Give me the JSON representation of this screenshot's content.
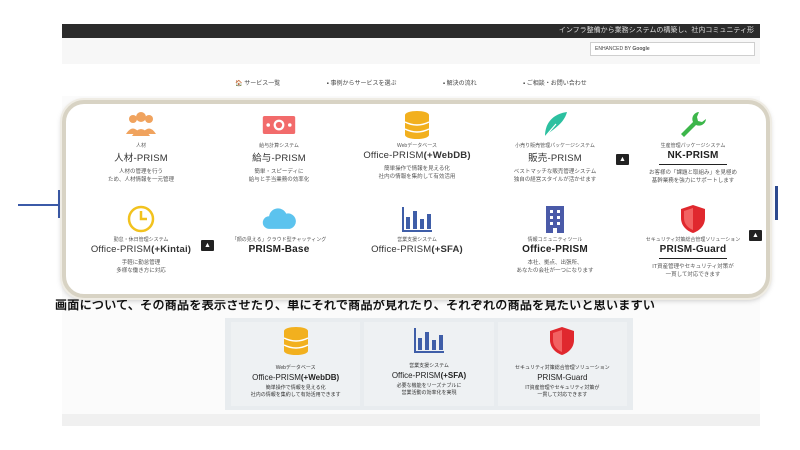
{
  "site": {
    "topbar_text": "インフラ整備から業務システムの構築し、社内コミュニティ形",
    "search": {
      "prefix": "ENHANCED BY",
      "brand": "Google"
    },
    "nav": [
      {
        "label": "🏠 サービス一覧"
      },
      {
        "label": "▪ 事例からサービスを選ぶ"
      },
      {
        "label": "▪ 解決の流れ"
      },
      {
        "label": "▪ ご相談・お問い合わせ"
      }
    ],
    "caption": "画面について、その商品を表示させたり、単にそれで商品が見れたり、それぞれの商品を見たいと思いますい"
  },
  "colors": {
    "people": "#f0a35e",
    "money": "#f26b6b",
    "db": "#f2b01e",
    "feather": "#2cc0a0",
    "wrench": "#3cb64a",
    "clock": "#f2c21e",
    "cloud": "#5cc3ee",
    "chart": "#3f5ea8",
    "building": "#4a5aa8",
    "shield": "#e0282e"
  },
  "overlay_tiles": [
    {
      "icon": "people-icon",
      "small": "人材",
      "name": "人材-PRISM",
      "name_bold": "",
      "bold_only": false,
      "desc": "人材の管理を行う\nため、人材情報を一元管理"
    },
    {
      "icon": "money-icon",
      "small": "給与計算システム",
      "name": "給与-PRISM",
      "name_bold": "",
      "bold_only": false,
      "desc": "簡単・スピーディに\n給与と手当業務の効率化"
    },
    {
      "icon": "database-icon",
      "small": "Webデータベース",
      "name": "Office-PRISM",
      "name_bold": "(+WebDB)",
      "bold_only": false,
      "desc": "簡単操作で情報を見える化\n社内の情報を集約して有効活用"
    },
    {
      "icon": "feather-icon",
      "small": "小売り販売管理パッケージシステム",
      "name": "販売-PRISM",
      "name_bold": "",
      "bold_only": false,
      "desc": "ベストマッチな販売管理システム\n独自の経営スタイルが活かせます"
    },
    {
      "icon": "wrench-icon",
      "small": "生産管理パッケージシステム",
      "name": "NK-PRISM",
      "name_bold": "",
      "bold_only": true,
      "desc": "お客様の「課題と取組み」を見極め\n基幹業務を強力にサポートします",
      "uline": true,
      "upbtn": true
    },
    {
      "icon": "clock-icon",
      "small": "勤怠・休日管理システム",
      "name": "Office-PRISM",
      "name_bold": "(+Kintai)",
      "bold_only": false,
      "desc": "手軽に勤怠管理\n多様な働き方に対応",
      "upbtn": true
    },
    {
      "icon": "cloud-icon",
      "small": "「顔の見える」クラウド型チャッティング",
      "name": "PRISM-Base",
      "name_bold": "",
      "bold_only": true,
      "desc": ""
    },
    {
      "icon": "chart-icon",
      "small": "営業支援システム",
      "name": "Office-PRISM",
      "name_bold": "(+SFA)",
      "bold_only": false,
      "desc": ""
    },
    {
      "icon": "building-icon",
      "small": "情報コミュニティツール",
      "name": "Office-PRISM",
      "name_bold": "",
      "bold_only": true,
      "desc": "本社、拠点、出張所、\nあなたの会社が一つになります"
    },
    {
      "icon": "shield-icon",
      "small": "セキュリティ対策総合管理ソリューション",
      "name": "PRISM-Guard",
      "name_bold": "",
      "bold_only": true,
      "desc": "IT資産管理やセキュリティ対策が\n一貫して対応できます",
      "uline": true,
      "upbtn": true
    }
  ],
  "up_label": "▲",
  "lower_tiles": [
    {
      "icon": "database-icon",
      "small": "Webデータベース",
      "name": "Office-PRISM",
      "name_bold": "(+WebDB)",
      "desc": "簡単操作で情報を見える化\n社内の情報を集約して有効活用できます"
    },
    {
      "icon": "chart-icon",
      "small": "営業支援システム",
      "name": "Office-PRISM",
      "name_bold": "(+SFA)",
      "desc": "必要な機能をリーズナブルに\n営業活動の効率化を実現"
    },
    {
      "icon": "shield-icon",
      "small": "セキュリティ対策総合管理ソリューション",
      "name": "PRISM-Guard",
      "name_bold": "",
      "desc": "IT資産管理やセキュリティ対策が\n一貫して対応できます"
    }
  ]
}
